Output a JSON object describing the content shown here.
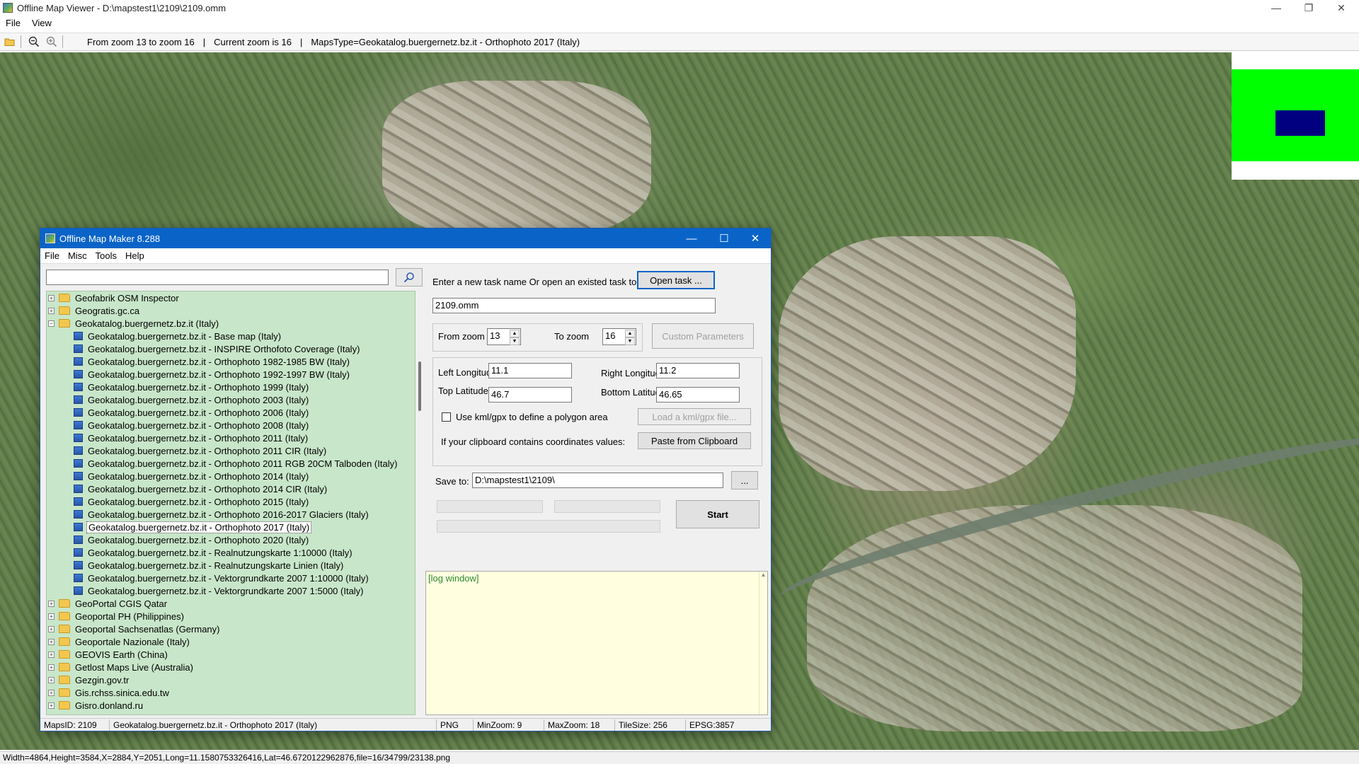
{
  "viewer": {
    "title": "Offline Map Viewer - D:\\mapstest1\\2109\\2109.omm",
    "menu": [
      "File",
      "View"
    ],
    "toolbar": {
      "zoom_range": "From zoom 13 to zoom 16",
      "sep1": "|",
      "current_zoom": "Current zoom is 16",
      "sep2": "|",
      "maps_type": "MapsType=Geokatalog.buergernetz.bz.it - Orthophoto 2017 (Italy)"
    },
    "status": "Width=4864,Height=3584,X=2884,Y=2051,Long=11.1580753326416,Lat=46.6720122962876,file=16/34799/23138.png",
    "controls": {
      "minimize": "—",
      "restore": "❐",
      "close": "✕"
    }
  },
  "dialog": {
    "title": "Offline Map Maker 8.288",
    "menu": [
      "File",
      "Misc",
      "Tools",
      "Help"
    ],
    "controls": {
      "minimize": "—",
      "maximize": "☐",
      "close": "✕"
    },
    "search": {
      "value": ""
    },
    "tree": [
      {
        "type": "folder",
        "label": "Geofabrik OSM Inspector",
        "expanded": false
      },
      {
        "type": "folder",
        "label": "Geogratis.gc.ca",
        "expanded": false
      },
      {
        "type": "folder",
        "label": "Geokatalog.buergernetz.bz.it (Italy)",
        "expanded": true
      },
      {
        "type": "leaf",
        "label": "Geokatalog.buergernetz.bz.it - Base map (Italy)"
      },
      {
        "type": "leaf",
        "label": "Geokatalog.buergernetz.bz.it - INSPIRE Orthofoto Coverage (Italy)"
      },
      {
        "type": "leaf",
        "label": "Geokatalog.buergernetz.bz.it - Orthophoto 1982-1985 BW (Italy)"
      },
      {
        "type": "leaf",
        "label": "Geokatalog.buergernetz.bz.it - Orthophoto 1992-1997 BW (Italy)"
      },
      {
        "type": "leaf",
        "label": "Geokatalog.buergernetz.bz.it - Orthophoto 1999 (Italy)"
      },
      {
        "type": "leaf",
        "label": "Geokatalog.buergernetz.bz.it - Orthophoto 2003 (Italy)"
      },
      {
        "type": "leaf",
        "label": "Geokatalog.buergernetz.bz.it - Orthophoto 2006 (Italy)"
      },
      {
        "type": "leaf",
        "label": "Geokatalog.buergernetz.bz.it - Orthophoto 2008 (Italy)"
      },
      {
        "type": "leaf",
        "label": "Geokatalog.buergernetz.bz.it - Orthophoto 2011 (Italy)"
      },
      {
        "type": "leaf",
        "label": "Geokatalog.buergernetz.bz.it - Orthophoto 2011 CIR (Italy)"
      },
      {
        "type": "leaf",
        "label": "Geokatalog.buergernetz.bz.it - Orthophoto 2011 RGB 20CM Talboden (Italy)"
      },
      {
        "type": "leaf",
        "label": "Geokatalog.buergernetz.bz.it - Orthophoto 2014 (Italy)"
      },
      {
        "type": "leaf",
        "label": "Geokatalog.buergernetz.bz.it - Orthophoto 2014 CIR (Italy)"
      },
      {
        "type": "leaf",
        "label": "Geokatalog.buergernetz.bz.it - Orthophoto 2015 (Italy)"
      },
      {
        "type": "leaf",
        "label": "Geokatalog.buergernetz.bz.it - Orthophoto 2016-2017 Glaciers (Italy)"
      },
      {
        "type": "leaf",
        "label": "Geokatalog.buergernetz.bz.it - Orthophoto 2017 (Italy)",
        "selected": true
      },
      {
        "type": "leaf",
        "label": "Geokatalog.buergernetz.bz.it - Orthophoto 2020 (Italy)"
      },
      {
        "type": "leaf",
        "label": "Geokatalog.buergernetz.bz.it - Realnutzungskarte 1:10000 (Italy)"
      },
      {
        "type": "leaf",
        "label": "Geokatalog.buergernetz.bz.it - Realnutzungskarte Linien (Italy)"
      },
      {
        "type": "leaf",
        "label": "Geokatalog.buergernetz.bz.it - Vektorgrundkarte 2007 1:10000 (Italy)"
      },
      {
        "type": "leaf",
        "label": "Geokatalog.buergernetz.bz.it - Vektorgrundkarte 2007 1:5000 (Italy)"
      },
      {
        "type": "folder",
        "label": "GeoPortal CGIS Qatar",
        "expanded": false
      },
      {
        "type": "folder",
        "label": "Geoportal PH (Philippines)",
        "expanded": false
      },
      {
        "type": "folder",
        "label": "Geoportal Sachsenatlas (Germany)",
        "expanded": false
      },
      {
        "type": "folder",
        "label": "Geoportale Nazionale (Italy)",
        "expanded": false
      },
      {
        "type": "folder",
        "label": "GEOVIS Earth (China)",
        "expanded": false
      },
      {
        "type": "folder",
        "label": "Getlost Maps Live (Australia)",
        "expanded": false
      },
      {
        "type": "folder",
        "label": "Gezgin.gov.tr",
        "expanded": false
      },
      {
        "type": "folder",
        "label": "Gis.rchss.sinica.edu.tw",
        "expanded": false
      },
      {
        "type": "folder",
        "label": "Gisro.donland.ru",
        "expanded": false
      }
    ],
    "task": {
      "prompt": "Enter a new task name Or open an existed task to continue:",
      "open_button": "Open task ...",
      "task_name": "2109.omm"
    },
    "zoom": {
      "from_label": "From zoom",
      "from_value": "13",
      "to_label": "To zoom",
      "to_value": "16",
      "custom_button": "Custom Parameters"
    },
    "coords": {
      "left_lon_label": "Left Longitude",
      "left_lon": "11.1",
      "right_lon_label": "Right Longitude",
      "right_lon": "11.2",
      "top_lat_label": "Top Latitude",
      "top_lat": "46.7",
      "bottom_lat_label": "Bottom Latitude",
      "bottom_lat": "46.65",
      "kml_checkbox_label": "Use kml/gpx to define a polygon area",
      "kml_button": "Load a kml/gpx file...",
      "clipboard_label": "If your clipboard contains coordinates values:",
      "clipboard_button": "Paste from Clipboard"
    },
    "save": {
      "label": "Save to:",
      "path": "D:\\mapstest1\\2109\\",
      "browse_button": "...",
      "start_button": "Start"
    },
    "log": {
      "text": "[log window]"
    },
    "status": {
      "maps_id": "MapsID: 2109",
      "map_name": "Geokatalog.buergernetz.bz.it - Orthophoto 2017 (Italy)",
      "format": "PNG",
      "min_zoom": "MinZoom: 9",
      "max_zoom": "MaxZoom: 18",
      "tile_size": "TileSize: 256",
      "epsg": "EPSG:3857"
    }
  },
  "colors": {
    "dialog_title_bar": "#0a64c8",
    "tree_background": "#c8e6c9",
    "log_background": "#ffffe0",
    "overview_green": "#00ff00",
    "overview_view": "#000080"
  }
}
